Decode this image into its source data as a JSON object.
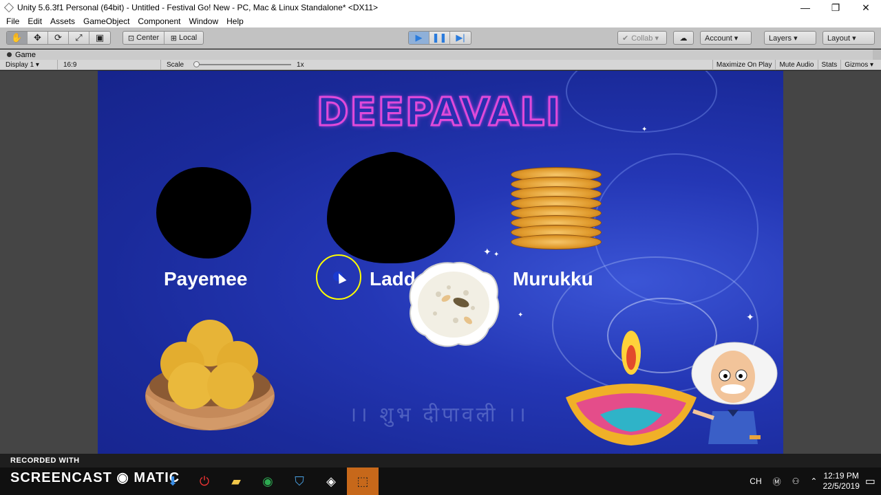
{
  "window": {
    "title": "Unity 5.6.3f1 Personal (64bit) - Untitled - Festival Go! New - PC, Mac & Linux Standalone* <DX11>",
    "minimize": "—",
    "maximize": "❐",
    "close": "✕"
  },
  "menu": [
    "File",
    "Edit",
    "Assets",
    "GameObject",
    "Component",
    "Window",
    "Help"
  ],
  "toolbar": {
    "pivot": "Center",
    "space": "Local",
    "collab": "Collab ▾",
    "account": "Account ▾",
    "layers": "Layers ▾",
    "layout": "Layout ▾"
  },
  "game_panel": {
    "tab": "Game",
    "display": "Display 1 ▾",
    "aspect": "16:9",
    "scale_label": "Scale",
    "scale_value": "1x",
    "maximize_on_play": "Maximize On Play",
    "mute_audio": "Mute Audio",
    "stats": "Stats",
    "gizmos": "Gizmos ▾"
  },
  "game": {
    "title": "DEEPAVALI",
    "labels": {
      "payemee": "Payemee",
      "laddu": "Ladd",
      "murukku": "Murukku"
    },
    "watermark": "।। शुभ दीपावली ।।"
  },
  "overlay": {
    "recorded_with": "RECORDED WITH",
    "screencast": "SCREENCAST ◉ MATIC"
  },
  "taskbar": {
    "lang": "CH",
    "time": "12:19 PM",
    "date": "22/5/2019"
  },
  "colors": {
    "game_bg": "#1a2a9a",
    "title_stroke": "#e04ad9",
    "taskbar_active": "#c7681a"
  }
}
